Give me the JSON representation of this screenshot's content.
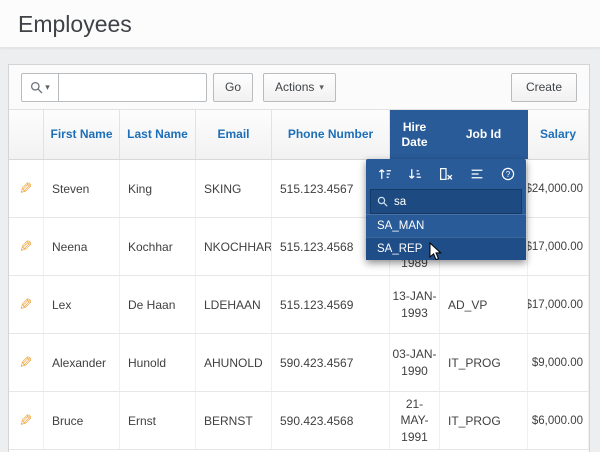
{
  "page": {
    "title": "Employees"
  },
  "icons": {
    "pencil": "✎",
    "caret": "▾"
  },
  "toolbar": {
    "search_value": "",
    "go_label": "Go",
    "actions_label": "Actions",
    "create_label": "Create"
  },
  "grid": {
    "columns": {
      "first_name": "First Name",
      "last_name": "Last Name",
      "email": "Email",
      "phone": "Phone Number",
      "hire_date": "Hire Date",
      "job_id": "Job Id",
      "salary": "Salary"
    },
    "rows": [
      {
        "first_name": "Steven",
        "last_name": "King",
        "email": "SKING",
        "phone": "515.123.4567",
        "hire_date": "",
        "job_id": "",
        "salary": "$24,000.00"
      },
      {
        "first_name": "Neena",
        "last_name": "Kochhar",
        "email": "NKOCHHAR",
        "phone": "515.123.4568",
        "hire_date": "1989",
        "job_id": "",
        "salary": "$17,000.00"
      },
      {
        "first_name": "Lex",
        "last_name": "De Haan",
        "email": "LDEHAAN",
        "phone": "515.123.4569",
        "hire_date": "13-JAN-1993",
        "job_id": "AD_VP",
        "salary": "$17,000.00"
      },
      {
        "first_name": "Alexander",
        "last_name": "Hunold",
        "email": "AHUNOLD",
        "phone": "590.423.4567",
        "hire_date": "03-JAN-1990",
        "job_id": "IT_PROG",
        "salary": "$9,000.00"
      },
      {
        "first_name": "Bruce",
        "last_name": "Ernst",
        "email": "BERNST",
        "phone": "590.423.4568",
        "hire_date": "21-MAY-1991",
        "job_id": "IT_PROG",
        "salary": "$6,000.00"
      }
    ]
  },
  "column_menu": {
    "search_value": "sa",
    "items": [
      "SA_MAN",
      "SA_REP"
    ],
    "icon_names": [
      "sort-ascending",
      "sort-descending",
      "hide-column",
      "control-break",
      "help"
    ]
  },
  "colors": {
    "header_text_blue": "#1d6fb8",
    "menu_blue": "#2a5b99",
    "menu_dark_blue": "#1d4a80",
    "pencil_orange": "#eda33c"
  }
}
